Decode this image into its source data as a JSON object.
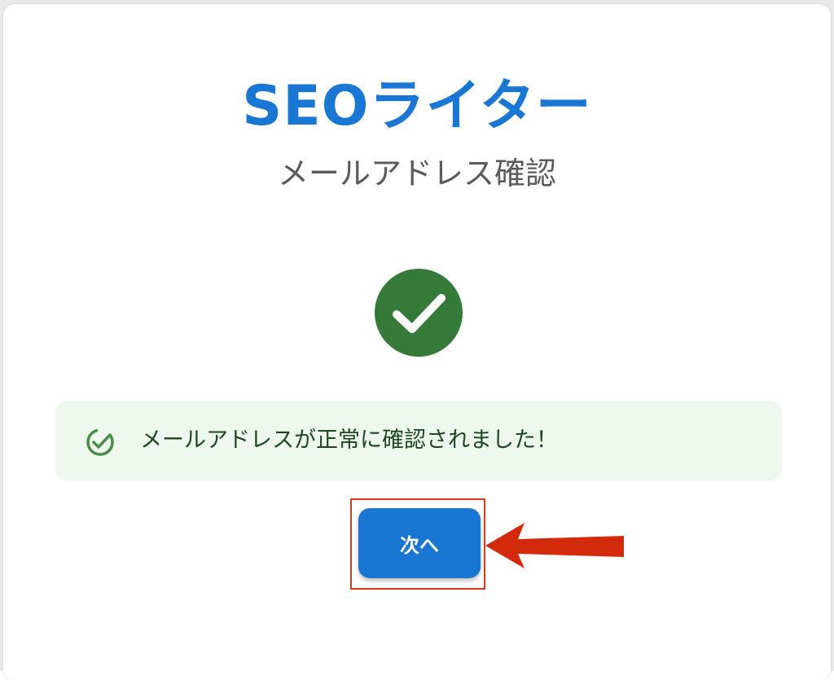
{
  "app": {
    "brand": "SEOライター",
    "page_title": "メールアドレス確認"
  },
  "alert": {
    "message": "メールアドレスが正常に確認されました！",
    "icon": "check-circle-outline-icon"
  },
  "status_icon": "check-circle-icon",
  "actions": {
    "next_label": "次へ"
  },
  "annotation": {
    "arrow_icon": "red-arrow-left-icon",
    "highlight": "red-highlight-box"
  },
  "colors": {
    "brand_blue": "#1976d2",
    "success_green": "#357a38",
    "alert_bg": "#edf7ed",
    "alert_text": "#1e4620",
    "annotation_red": "#d93a1a",
    "subtitle_gray": "#5a5a5a"
  }
}
